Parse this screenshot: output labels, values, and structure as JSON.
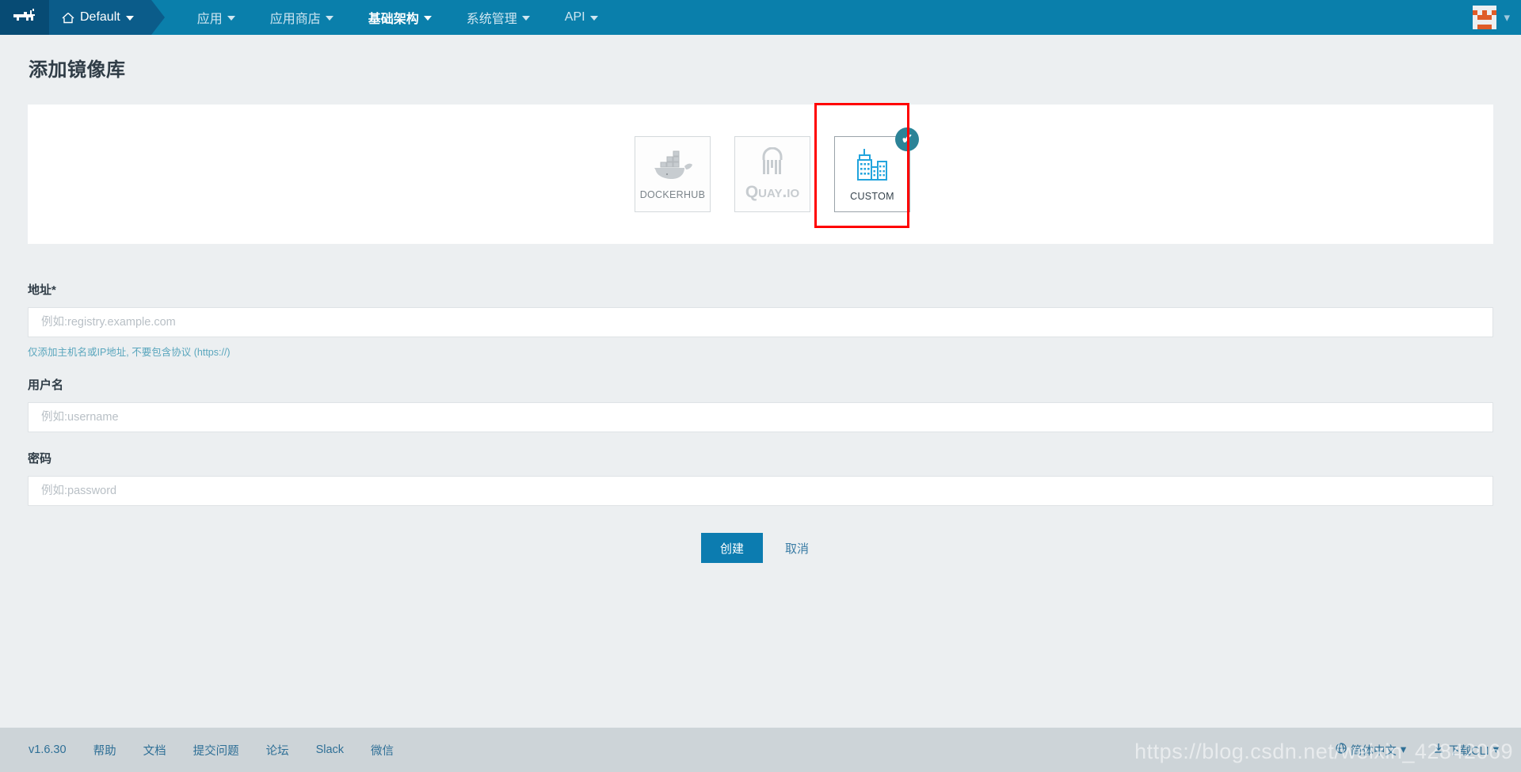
{
  "navbar": {
    "logo_icon": "rancher-cow-logo",
    "cluster": {
      "label": "Default",
      "icon": "home-icon"
    },
    "items": [
      {
        "label": "应用",
        "active": false
      },
      {
        "label": "应用商店",
        "active": false
      },
      {
        "label": "基础架构",
        "active": true
      },
      {
        "label": "系统管理",
        "active": false
      },
      {
        "label": "API",
        "active": false
      }
    ],
    "avatar_icon": "user-avatar-identicon",
    "avatar_caret_icon": "chevron-down-icon"
  },
  "page": {
    "title": "添加镜像库"
  },
  "registry_picker": {
    "cards": [
      {
        "name": "dockerhub",
        "label": "DockerHub",
        "icon": "docker-whale-icon",
        "selected": false
      },
      {
        "name": "quay",
        "label": "Quay.io",
        "icon": "quay-lock-icon",
        "selected": false
      },
      {
        "name": "custom",
        "label": "Custom",
        "icon": "buildings-icon",
        "selected": true
      }
    ],
    "selected_badge_icon": "check-circle-icon",
    "selected_badge_color": "#2c8397",
    "annotation_color": "#ff0000"
  },
  "form": {
    "address": {
      "label": "地址",
      "required_mark": "*",
      "value": "",
      "placeholder": "例如:registry.example.com",
      "hint": "仅添加主机名或IP地址, 不要包含协议 (https://)"
    },
    "username": {
      "label": "用户名",
      "value": "",
      "placeholder": "例如:username"
    },
    "password": {
      "label": "密码",
      "value": "",
      "placeholder": "例如:password"
    },
    "submit_label": "创建",
    "cancel_label": "取消"
  },
  "footer": {
    "version": "v1.6.30",
    "links": [
      "帮助",
      "文档",
      "提交问题",
      "论坛",
      "Slack",
      "微信"
    ],
    "language": {
      "label": "简体中文",
      "icon": "globe-icon",
      "caret_icon": "chevron-down-icon"
    },
    "download_cli": {
      "label": "下载CLI",
      "icon": "download-icon",
      "caret_icon": "chevron-down-icon"
    }
  },
  "watermark": {
    "text": "https://blog.csdn.net/weixin_42842069"
  }
}
